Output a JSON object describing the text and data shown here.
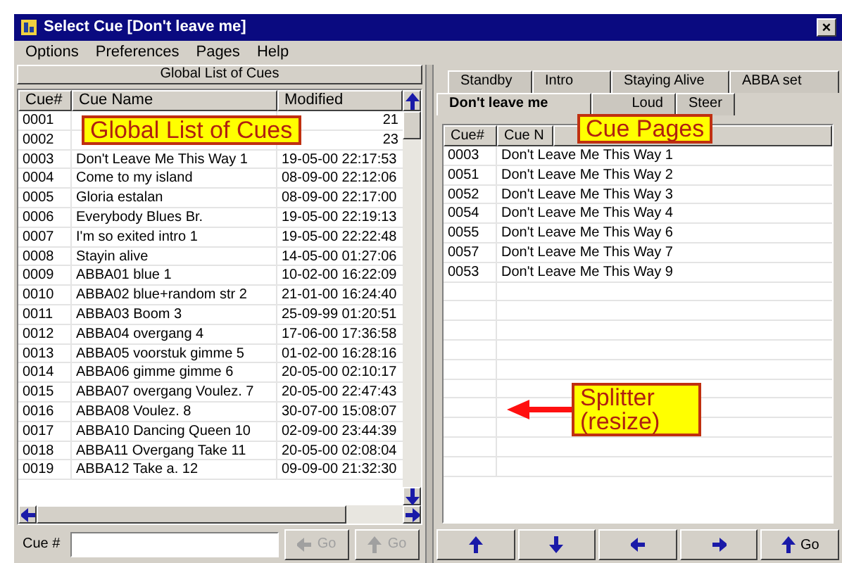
{
  "window": {
    "title": "Select Cue [Don't leave me]",
    "close": "×"
  },
  "menu": [
    "Options",
    "Preferences",
    "Pages",
    "Help"
  ],
  "left_panel": {
    "title": "Global List of Cues",
    "columns": [
      "Cue#",
      "Cue Name",
      "Modified"
    ],
    "rows": [
      {
        "cue": "0001",
        "name": "",
        "modified": "21"
      },
      {
        "cue": "0002",
        "name": "",
        "modified": "23"
      },
      {
        "cue": "0003",
        "name": "Don't Leave Me This Way 1",
        "modified": "19-05-00 22:17:53"
      },
      {
        "cue": "0004",
        "name": "Come to my island",
        "modified": "08-09-00 22:12:06"
      },
      {
        "cue": "0005",
        "name": "Gloria estalan",
        "modified": "08-09-00 22:17:00"
      },
      {
        "cue": "0006",
        "name": "Everybody Blues Br.",
        "modified": "19-05-00 22:19:13"
      },
      {
        "cue": "0007",
        "name": "I'm so exited intro 1",
        "modified": "19-05-00 22:22:48"
      },
      {
        "cue": "0008",
        "name": "Stayin alive",
        "modified": "14-05-00 01:27:06"
      },
      {
        "cue": "0009",
        "name": "ABBA01 blue 1",
        "modified": "10-02-00 16:22:09"
      },
      {
        "cue": "0010",
        "name": "ABBA02 blue+random str 2",
        "modified": "21-01-00 16:24:40"
      },
      {
        "cue": "0011",
        "name": "ABBA03 Boom 3",
        "modified": "25-09-99 01:20:51"
      },
      {
        "cue": "0012",
        "name": "ABBA04 overgang 4",
        "modified": "17-06-00 17:36:58"
      },
      {
        "cue": "0013",
        "name": "ABBA05 voorstuk gimme 5",
        "modified": "01-02-00 16:28:16"
      },
      {
        "cue": "0014",
        "name": "ABBA06 gimme gimme 6",
        "modified": "20-05-00 02:10:17"
      },
      {
        "cue": "0015",
        "name": "ABBA07 overgang Voulez. 7",
        "modified": "20-05-00 22:47:43"
      },
      {
        "cue": "0016",
        "name": "ABBA08 Voulez. 8",
        "modified": "30-07-00 15:08:07"
      },
      {
        "cue": "0017",
        "name": "ABBA10 Dancing Queen 10",
        "modified": "02-09-00 23:44:39"
      },
      {
        "cue": "0018",
        "name": "ABBA11 Overgang Take 11",
        "modified": "20-05-00 02:08:04"
      },
      {
        "cue": "0019",
        "name": "ABBA12 Take a. 12",
        "modified": "09-09-00 21:32:30"
      }
    ],
    "cue_label": "Cue #",
    "buttons": [
      {
        "label": "Go",
        "kind": "left",
        "disabled": true
      },
      {
        "label": "Go",
        "kind": "up",
        "disabled": true
      }
    ]
  },
  "right_panel": {
    "tab_rows": [
      [
        {
          "label": "Standby",
          "selected": false
        },
        {
          "label": "Intro",
          "selected": false
        },
        {
          "label": "Staying Alive",
          "selected": false
        },
        {
          "label": "ABBA set",
          "selected": false
        }
      ],
      [
        {
          "label": "Don't leave me",
          "selected": true
        },
        {
          "label": "Loud",
          "selected": false
        },
        {
          "label": "Steer",
          "selected": false
        }
      ]
    ],
    "columns": [
      "Cue#",
      "Cue N"
    ],
    "rows": [
      {
        "cue": "0003",
        "name": "Don't Leave Me This Way 1"
      },
      {
        "cue": "0051",
        "name": "Don't Leave Me This Way 2"
      },
      {
        "cue": "0052",
        "name": "Don't Leave Me This Way 3"
      },
      {
        "cue": "0054",
        "name": "Don't Leave Me This Way 4"
      },
      {
        "cue": "0055",
        "name": "Don't Leave Me This Way 6"
      },
      {
        "cue": "0057",
        "name": "Don't Leave Me This Way 7"
      },
      {
        "cue": "0053",
        "name": "Don't Leave Me This Way 9"
      }
    ],
    "buttons": [
      {
        "kind": "up"
      },
      {
        "kind": "down"
      },
      {
        "kind": "left"
      },
      {
        "kind": "right"
      },
      {
        "kind": "up",
        "label": "Go"
      }
    ]
  },
  "callouts": [
    {
      "kind": "list",
      "text": "Global List of Cues"
    },
    {
      "kind": "pages",
      "text": "Cue Pages"
    },
    {
      "kind": "splitter",
      "text": "Splitter (resize)"
    }
  ]
}
